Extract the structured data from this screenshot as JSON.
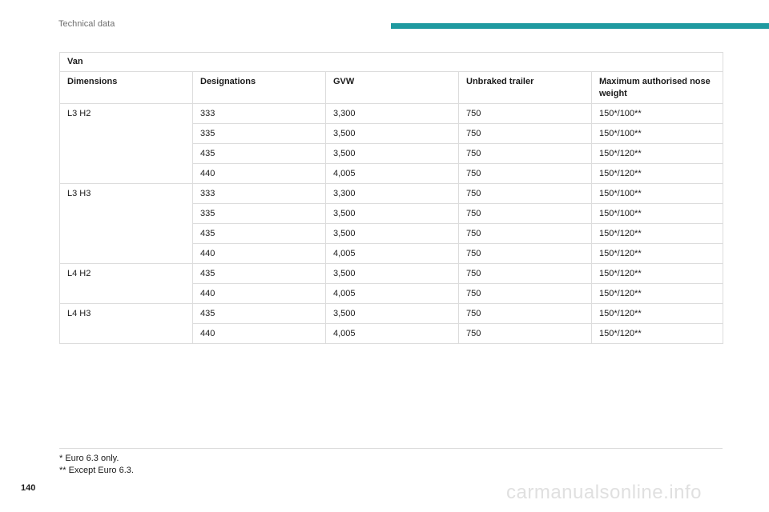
{
  "header": {
    "section_title": "Technical data",
    "accent_color": "#1f9aa0"
  },
  "table": {
    "caption": "Van",
    "columns": [
      "Dimensions",
      "Designations",
      "GVW",
      "Unbraked trailer",
      "Maximum authorised nose weight"
    ],
    "groups": [
      {
        "dimension": "L3 H2",
        "rows": [
          [
            "333",
            "3,300",
            "750",
            "150*/100**"
          ],
          [
            "335",
            "3,500",
            "750",
            "150*/100**"
          ],
          [
            "435",
            "3,500",
            "750",
            "150*/120**"
          ],
          [
            "440",
            "4,005",
            "750",
            "150*/120**"
          ]
        ]
      },
      {
        "dimension": "L3 H3",
        "rows": [
          [
            "333",
            "3,300",
            "750",
            "150*/100**"
          ],
          [
            "335",
            "3,500",
            "750",
            "150*/100**"
          ],
          [
            "435",
            "3,500",
            "750",
            "150*/120**"
          ],
          [
            "440",
            "4,005",
            "750",
            "150*/120**"
          ]
        ]
      },
      {
        "dimension": "L4 H2",
        "rows": [
          [
            "435",
            "3,500",
            "750",
            "150*/120**"
          ],
          [
            "440",
            "4,005",
            "750",
            "150*/120**"
          ]
        ]
      },
      {
        "dimension": "L4 H3",
        "rows": [
          [
            "435",
            "3,500",
            "750",
            "150*/120**"
          ],
          [
            "440",
            "4,005",
            "750",
            "150*/120**"
          ]
        ]
      }
    ]
  },
  "footnotes": [
    "* Euro 6.3 only.",
    "** Except Euro 6.3."
  ],
  "page_number": "140",
  "watermark": "carmanualsonline.info"
}
